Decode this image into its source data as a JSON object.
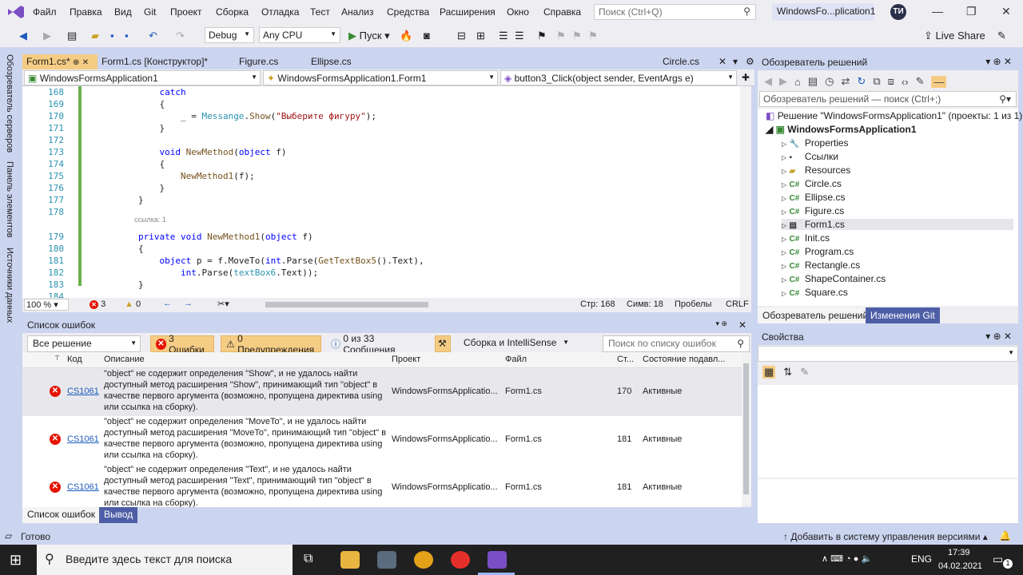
{
  "menu": {
    "items": [
      "Файл",
      "Правка",
      "Вид",
      "Git",
      "Проект",
      "Сборка",
      "Отладка",
      "Тест",
      "Анализ",
      "Средства",
      "Расширения",
      "Окно",
      "Справка"
    ],
    "search_placeholder": "Поиск (Ctrl+Q)",
    "solution_name": "WindowsFo...plication1",
    "avatar": "ТИ"
  },
  "toolbar": {
    "config": "Debug",
    "platform": "Any CPU",
    "start_label": "Пуск",
    "live_share": "Live Share"
  },
  "left_tabs": [
    "Обозреватель серверов",
    "Панель элементов",
    "Источники данных"
  ],
  "editor_tabs": [
    {
      "label": "Form1.cs*",
      "pin": "⊕",
      "close": "✕"
    },
    {
      "label": "Form1.cs [Конструктор]*"
    },
    {
      "label": "Figure.cs"
    },
    {
      "label": "Ellipse.cs"
    },
    {
      "label": "Circle.cs"
    }
  ],
  "nav": {
    "project": "WindowsFormsApplication1",
    "class": "WindowsFormsApplication1.Form1",
    "member": "button3_Click(object sender, EventArgs e)"
  },
  "code_lines": [
    {
      "n": "168",
      "html": "            <span class='kw'>catch</span>"
    },
    {
      "n": "169",
      "html": "            {"
    },
    {
      "n": "170",
      "html": "                _ = <span class='ty'>Messange</span>.<span class='mt'>Show</span>(<span class='str'>\"Выберите фигуру\"</span>);"
    },
    {
      "n": "171",
      "html": "            }"
    },
    {
      "n": "172",
      "html": ""
    },
    {
      "n": "173",
      "html": "            <span class='kw'>void</span> <span class='mt'>NewMethod</span>(<span class='kw'>object</span> f)"
    },
    {
      "n": "174",
      "html": "            {"
    },
    {
      "n": "175",
      "html": "                <span class='mt'>NewMethod1</span>(f);"
    },
    {
      "n": "176",
      "html": "            }"
    },
    {
      "n": "177",
      "html": "        }"
    },
    {
      "n": "178",
      "html": ""
    },
    {
      "n": "179",
      "html": "        <span class='kw'>private</span> <span class='kw'>void</span> <span class='mt'>NewMethod1</span>(<span class='kw'>object</span> f)"
    },
    {
      "n": "180",
      "html": "        {"
    },
    {
      "n": "181",
      "html": "            <span class='kw'>object</span> p = f.MoveTo(<span class='kw'>int</span>.Parse(<span class='mt'>GetTextBox5</span>().Text),"
    },
    {
      "n": "182",
      "html": "                <span class='kw'>int</span>.Parse(<span class='ty'>textBox6</span>.Text));"
    },
    {
      "n": "183",
      "html": "        }"
    },
    {
      "n": "184",
      "html": ""
    }
  ],
  "refs_hint": "ссылка: 1",
  "editor_status": {
    "zoom": "100 %",
    "errors": "3",
    "warnings": "0",
    "line": "Стр: 168",
    "col": "Симв: 18",
    "spaces": "Пробелы",
    "eol": "CRLF"
  },
  "error_list": {
    "title": "Список ошибок",
    "scope": "Все решение",
    "errors_btn": "3 Ошибки",
    "warnings_btn": "0 Предупреждения",
    "messages_btn": "0 из 33 Сообщения",
    "source": "Сборка и IntelliSense",
    "search_placeholder": "Поиск по списку ошибок",
    "columns": [
      "Код",
      "Описание",
      "Проект",
      "Файл",
      "Ст...",
      "Состояние подавл..."
    ],
    "rows": [
      {
        "code": "CS1061",
        "desc": "\"object\" не содержит определения \"Show\", и не удалось найти доступный метод расширения \"Show\", принимающий тип \"object\" в качестве первого аргумента (возможно, пропущена директива using или ссылка на сборку).",
        "project": "WindowsFormsApplicatio...",
        "file": "Form1.cs",
        "line": "170",
        "state": "Активные"
      },
      {
        "code": "CS1061",
        "desc": "\"object\" не содержит определения \"MoveTo\", и не удалось найти доступный метод расширения \"MoveTo\", принимающий тип \"object\" в качестве первого аргумента (возможно, пропущена директива using или ссылка на сборку).",
        "project": "WindowsFormsApplicatio...",
        "file": "Form1.cs",
        "line": "181",
        "state": "Активные"
      },
      {
        "code": "CS1061",
        "desc": "\"object\" не содержит определения \"Text\", и не удалось найти доступный метод расширения \"Text\", принимающий тип \"object\" в качестве первого аргумента (возможно, пропущена директива using или ссылка на сборку).",
        "project": "WindowsFormsApplicatio...",
        "file": "Form1.cs",
        "line": "181",
        "state": "Активные"
      }
    ],
    "bottom_tabs": [
      "Список ошибок",
      "Вывод"
    ]
  },
  "solution_explorer": {
    "title": "Обозреватель решений",
    "search_placeholder": "Обозреватель решений — поиск (Ctrl+;)",
    "solution": "Решение \"WindowsFormsApplication1\" (проекты: 1 из 1)",
    "project": "WindowsFormsApplication1",
    "items": [
      {
        "label": "Properties",
        "icon": "wrench-icon"
      },
      {
        "label": "Ссылки",
        "icon": "references-icon"
      },
      {
        "label": "Resources",
        "icon": "folder-icon"
      },
      {
        "label": "Circle.cs",
        "icon": "cs-icon"
      },
      {
        "label": "Ellipse.cs",
        "icon": "cs-icon"
      },
      {
        "label": "Figure.cs",
        "icon": "cs-icon"
      },
      {
        "label": "Form1.cs",
        "icon": "form-icon"
      },
      {
        "label": "Init.cs",
        "icon": "cs-icon"
      },
      {
        "label": "Program.cs",
        "icon": "cs-icon"
      },
      {
        "label": "Rectangle.cs",
        "icon": "cs-icon"
      },
      {
        "label": "ShapeContainer.cs",
        "icon": "cs-icon"
      },
      {
        "label": "Square.cs",
        "icon": "cs-icon"
      }
    ],
    "bottom_tabs": [
      "Обозреватель решений",
      "Изменения Git"
    ]
  },
  "properties": {
    "title": "Свойства"
  },
  "status": {
    "ready": "Готово",
    "vcs": "Добавить в систему управления версиями"
  },
  "taskbar": {
    "search_placeholder": "Введите здесь текст для поиска",
    "lang": "ENG",
    "time": "17:39",
    "date": "04.02.2021",
    "notifications": "1"
  },
  "colors": {
    "accent": "#f5cc84",
    "frame": "#ccd5f0",
    "error": "#e51400"
  }
}
